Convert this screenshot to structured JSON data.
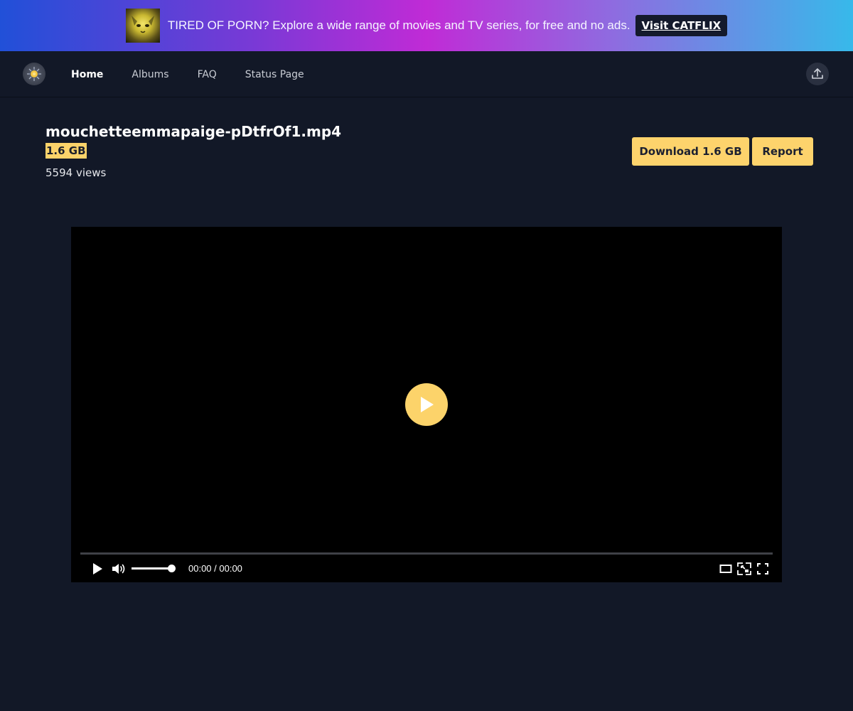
{
  "promo": {
    "thumbnail_icon": "cat-face-thumbnail",
    "text": "TIRED OF PORN? Explore a wide range of movies and TV series, for free and no ads.",
    "button_label": "Visit CATFLIX"
  },
  "nav": {
    "logo_icon": "gear-sun-logo-icon",
    "links": [
      {
        "label": "Home",
        "active": true
      },
      {
        "label": "Albums",
        "active": false
      },
      {
        "label": "FAQ",
        "active": false
      },
      {
        "label": "Status Page",
        "active": false
      }
    ],
    "upload_icon": "upload-icon"
  },
  "file": {
    "name": "mouchetteemmapaige-pDtfrOf1.mp4",
    "size": "1.6 GB",
    "views": "5594 views",
    "download_label": "Download 1.6 GB",
    "report_label": "Report"
  },
  "player": {
    "time": "00:00 / 00:00",
    "progress": 0,
    "volume": 1.0,
    "accent_color": "#fcd36a"
  },
  "colors": {
    "background": "#121827",
    "accent": "#fdd36c"
  }
}
